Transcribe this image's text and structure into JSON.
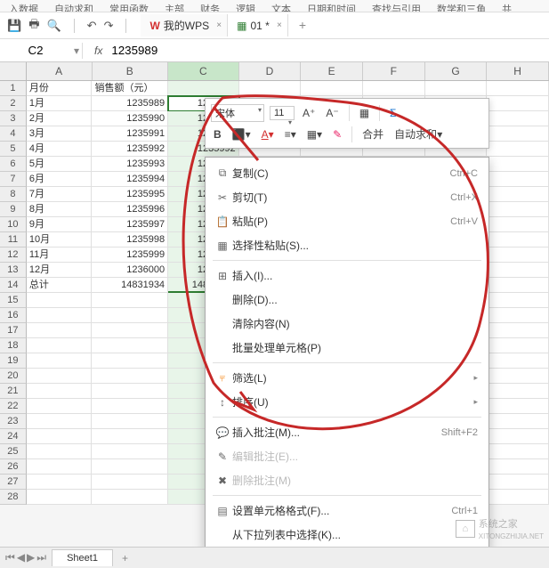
{
  "ribbon": {
    "tabs": [
      "入数据",
      "自动求和",
      "常用函数",
      "主部",
      "财务",
      "逻辑",
      "文本",
      "日期和时间",
      "查找与引用",
      "数学和三角",
      "共"
    ]
  },
  "docs": {
    "tab1": "我的WPS",
    "tab2": "01 *"
  },
  "formula_bar": {
    "cell_ref": "C2",
    "fx": "fx",
    "value": "1235989"
  },
  "columns": [
    "A",
    "B",
    "C",
    "D",
    "E",
    "F",
    "G",
    "H"
  ],
  "headers": {
    "A": "月份",
    "B": "销售额（元）"
  },
  "rows": [
    {
      "n": 2,
      "A": "1月",
      "B": "1235989",
      "C": "1235989"
    },
    {
      "n": 3,
      "A": "2月",
      "B": "1235990",
      "C": "1235990"
    },
    {
      "n": 4,
      "A": "3月",
      "B": "1235991",
      "C": "1235991"
    },
    {
      "n": 5,
      "A": "4月",
      "B": "1235992",
      "C": "1235992"
    },
    {
      "n": 6,
      "A": "5月",
      "B": "1235993",
      "C": "1235993"
    },
    {
      "n": 7,
      "A": "6月",
      "B": "1235994",
      "C": "1235994"
    },
    {
      "n": 8,
      "A": "7月",
      "B": "1235995",
      "C": "1235995"
    },
    {
      "n": 9,
      "A": "8月",
      "B": "1235996",
      "C": "1235996"
    },
    {
      "n": 10,
      "A": "9月",
      "B": "1235997",
      "C": "1235997"
    },
    {
      "n": 11,
      "A": "10月",
      "B": "1235998",
      "C": "1235998"
    },
    {
      "n": 12,
      "A": "11月",
      "B": "1235999",
      "C": "1235999"
    },
    {
      "n": 13,
      "A": "12月",
      "B": "1236000",
      "C": "1236000"
    },
    {
      "n": 14,
      "A": "总计",
      "B": "14831934",
      "C": "14831934"
    }
  ],
  "mini_toolbar": {
    "font": "宋体",
    "size": "11",
    "merge": "合并",
    "autosum": "自动求和"
  },
  "context_menu": {
    "copy": "复制(C)",
    "copy_sc": "Ctrl+C",
    "cut": "剪切(T)",
    "cut_sc": "Ctrl+X",
    "paste": "粘贴(P)",
    "paste_sc": "Ctrl+V",
    "paste_special": "选择性粘贴(S)...",
    "insert": "插入(I)...",
    "delete": "删除(D)...",
    "clear": "清除内容(N)",
    "batch": "批量处理单元格(P)",
    "filter": "筛选(L)",
    "sort": "排序(U)",
    "insert_comment": "插入批注(M)...",
    "insert_comment_sc": "Shift+F2",
    "edit_comment": "编辑批注(E)...",
    "delete_comment": "删除批注(M)",
    "format_cells": "设置单元格格式(F)...",
    "format_cells_sc": "Ctrl+1",
    "dropdown": "从下拉列表中选择(K)..."
  },
  "sheet": {
    "name": "Sheet1"
  },
  "watermark": {
    "text": "系统之家",
    "url": "XITONGZHIJIA.NET"
  }
}
